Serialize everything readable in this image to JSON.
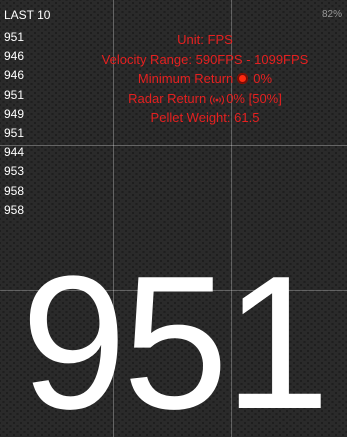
{
  "history": {
    "title": "LAST 10",
    "values": [
      "951",
      "946",
      "946",
      "951",
      "949",
      "951",
      "944",
      "953",
      "958",
      "958"
    ]
  },
  "status": {
    "battery": "82%"
  },
  "info": {
    "unit_label": "Unit:",
    "unit_value": "FPS",
    "velocity_label": "Velocity Range:",
    "velocity_value": "590FPS - 1099FPS",
    "min_return_label": "Minimum Return",
    "min_return_value": "0%",
    "radar_return_label": "Radar Return",
    "radar_return_value": "0%",
    "radar_return_extra": "[50%]",
    "pellet_weight_label": "Pellet Weight:",
    "pellet_weight_value": "61.5"
  },
  "readout": {
    "value": "951"
  },
  "colors": {
    "accent": "#e42020",
    "text": "#ffffff",
    "indicator": "#ff2a10"
  },
  "icons": {
    "minimum_return": "record-dot-icon",
    "radar_return": "radar-signal-icon"
  }
}
